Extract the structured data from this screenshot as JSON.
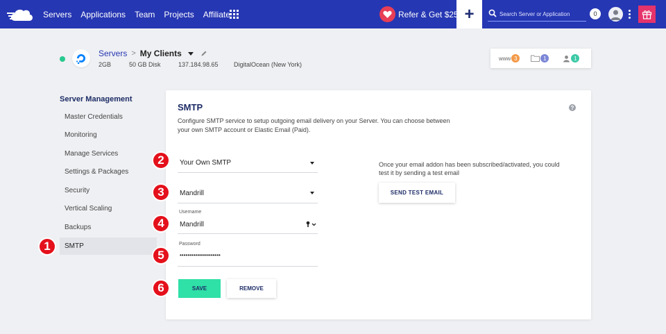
{
  "nav": {
    "links": [
      "Servers",
      "Applications",
      "Team",
      "Projects",
      "Affiliate"
    ],
    "refer_label": "Refer & Get $25",
    "add_label": "+",
    "search_placeholder": "Search Server or Application",
    "notification_count": "0",
    "brand_color": "#2637b3"
  },
  "server": {
    "breadcrumb_root": "Servers",
    "breadcrumb_sep": ">",
    "name": "My Clients",
    "ram": "2GB",
    "disk": "50 GB Disk",
    "ip": "137.184.98.65",
    "provider": "DigitalOcean (New York)",
    "status_color": "#27c98e",
    "stats": [
      {
        "icon": "www-icon",
        "label": "www",
        "count": "3",
        "color": "#f39a4a"
      },
      {
        "icon": "folder-icon",
        "label": "",
        "count": "1",
        "color": "#7b86d6"
      },
      {
        "icon": "users-icon",
        "label": "",
        "count": "1",
        "color": "#3cc9a6"
      }
    ]
  },
  "sidebar": {
    "heading": "Server Management",
    "items": [
      {
        "label": "Master Credentials"
      },
      {
        "label": "Monitoring"
      },
      {
        "label": "Manage Services"
      },
      {
        "label": "Settings & Packages"
      },
      {
        "label": "Security"
      },
      {
        "label": "Vertical Scaling"
      },
      {
        "label": "Backups"
      },
      {
        "label": "SMTP",
        "active": true
      }
    ]
  },
  "smtp": {
    "title": "SMTP",
    "help": "?",
    "description": "Configure SMTP service to setup outgoing email delivery on your Server. You can choose between your own SMTP account or Elastic Email (Paid).",
    "account_type": "Your Own SMTP",
    "provider": "Mandrill",
    "username_label": "Username",
    "username": "Mandrill",
    "password_label": "Password",
    "password": "•••••••••••••••••••••",
    "test_info": "Once your email addon has been subscribed/activated, you could test it by sending a test email",
    "test_button": "SEND TEST EMAIL",
    "save_button": "SAVE",
    "remove_button": "REMOVE",
    "save_color": "#2fe0a7"
  },
  "steps": [
    "1",
    "2",
    "3",
    "4",
    "5",
    "6"
  ]
}
